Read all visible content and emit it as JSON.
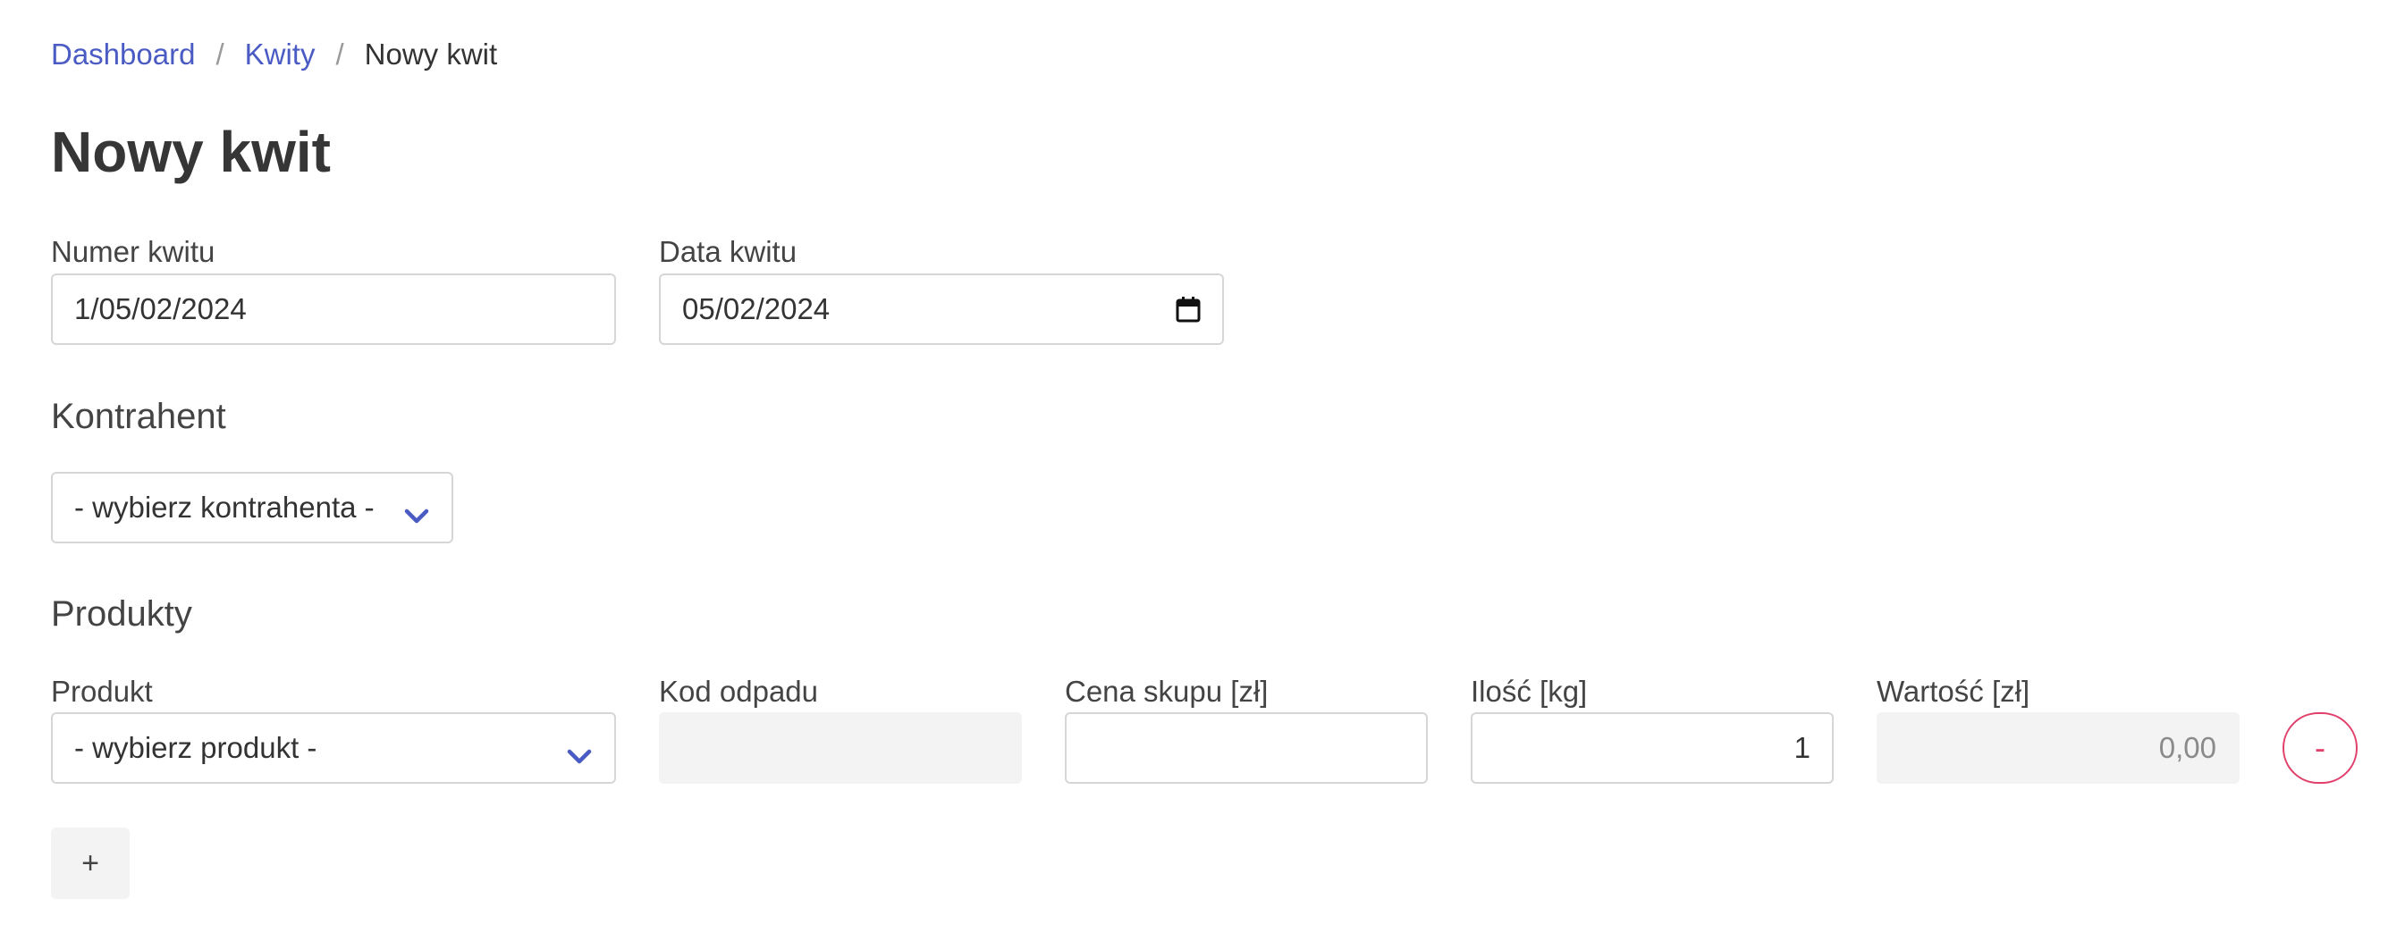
{
  "breadcrumb": {
    "items": [
      {
        "label": "Dashboard"
      },
      {
        "label": "Kwity"
      }
    ],
    "separator": "/",
    "current": "Nowy kwit"
  },
  "page": {
    "title": "Nowy kwit"
  },
  "form": {
    "numer_label": "Numer kwitu",
    "numer_value": "1/05/02/2024",
    "data_label": "Data kwitu",
    "data_value": "05/02/2024",
    "kontrahent_title": "Kontrahent",
    "kontrahent_select": "- wybierz kontrahenta -"
  },
  "produkty": {
    "title": "Produkty",
    "columns": {
      "produkt": "Produkt",
      "kod": "Kod odpadu",
      "cena": "Cena skupu [zł]",
      "ilosc": "Ilość [kg]",
      "wartosc": "Wartość [zł]"
    },
    "row": {
      "produkt": "- wybierz produkt -",
      "kod": "",
      "cena": "",
      "ilosc": "1",
      "wartosc": "0,00",
      "remove_label": "-"
    },
    "add_label": "+"
  },
  "colors": {
    "accent": "#4a5bc4",
    "danger": "#e0406a",
    "text": "#333333",
    "readonly_bg": "#f3f3f3"
  },
  "icons": {
    "select_chevron": "chevron-down-icon",
    "date_picker": "calendar-icon"
  }
}
